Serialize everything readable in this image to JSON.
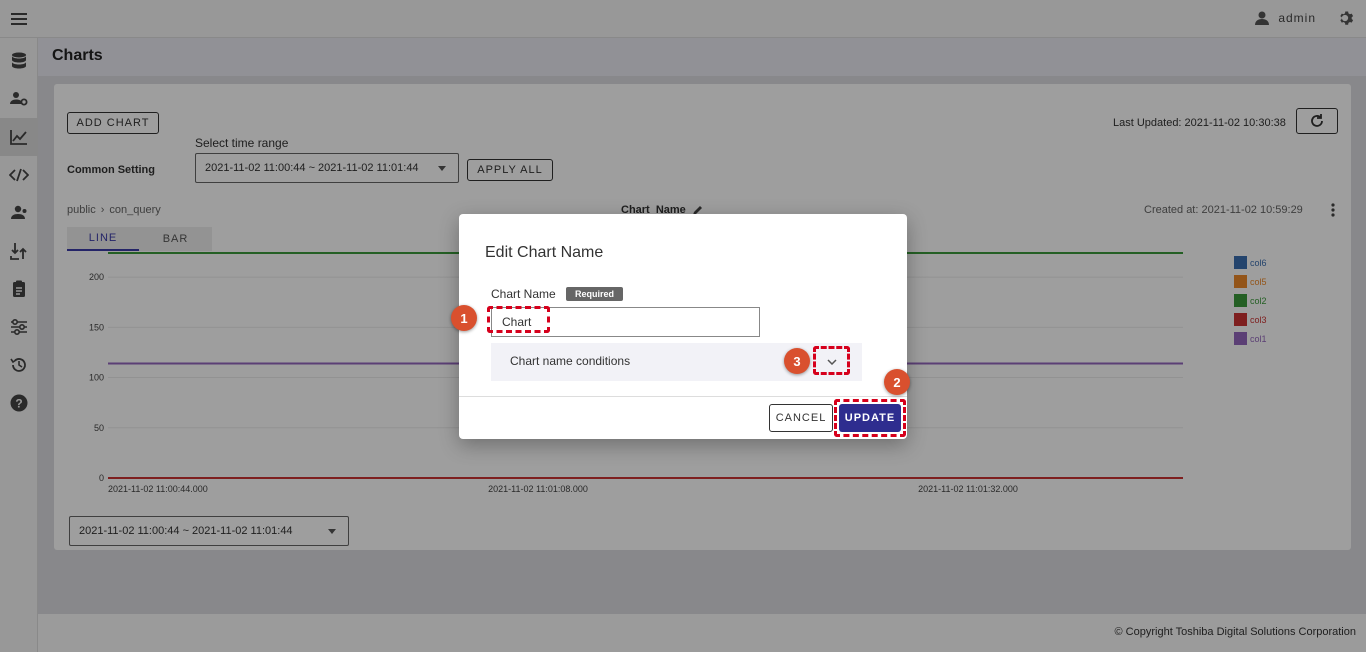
{
  "header": {
    "user": "admin"
  },
  "page": {
    "title": "Charts"
  },
  "toolbar": {
    "add_chart": "ADD CHART",
    "time_range_label": "Select time range",
    "common_setting": "Common Setting",
    "time_range_value": "2021-11-02 11:00:44 ~ 2021-11-02 11:01:44",
    "apply_all": "APPLY ALL",
    "last_updated": "Last Updated: 2021-11-02 10:30:38"
  },
  "chart_panel": {
    "breadcrumb_schema": "public",
    "breadcrumb_query": "con_query",
    "chart_name": "Chart_Name",
    "created_at": "Created at: 2021-11-02 10:59:29",
    "tabs": [
      "LINE",
      "BAR"
    ],
    "range_select": "2021-11-02 11:00:44 ~ 2021-11-02 11:01:44"
  },
  "chart_data": {
    "type": "line",
    "x": [
      "2021-11-02 11:00:44.000",
      "2021-11-02 11:01:08.000",
      "2021-11-02 11:01:32.000"
    ],
    "y_ticks": [
      0,
      50,
      100,
      150,
      200
    ],
    "ylim": [
      0,
      225
    ],
    "series": [
      {
        "name": "col6",
        "color": "#3b6eb0",
        "values": [
          null,
          null,
          null
        ]
      },
      {
        "name": "col5",
        "color": "#ee8a2a",
        "values": [
          null,
          null,
          null
        ]
      },
      {
        "name": "col2",
        "color": "#3a9a3a",
        "values": [
          224,
          224,
          224
        ]
      },
      {
        "name": "col3",
        "color": "#cc3333",
        "values": [
          0,
          0,
          0
        ]
      },
      {
        "name": "col1",
        "color": "#9467bd",
        "values": [
          114,
          114,
          114
        ]
      }
    ],
    "legend_position": "right"
  },
  "dialog": {
    "title": "Edit Chart Name",
    "field_label": "Chart Name",
    "required": "Required",
    "input_value": "Chart",
    "conditions_label": "Chart name conditions",
    "cancel": "CANCEL",
    "update": "UPDATE"
  },
  "annotations": [
    "1",
    "2",
    "3"
  ],
  "footer": {
    "copyright": "© Copyright Toshiba Digital Solutions Corporation"
  }
}
